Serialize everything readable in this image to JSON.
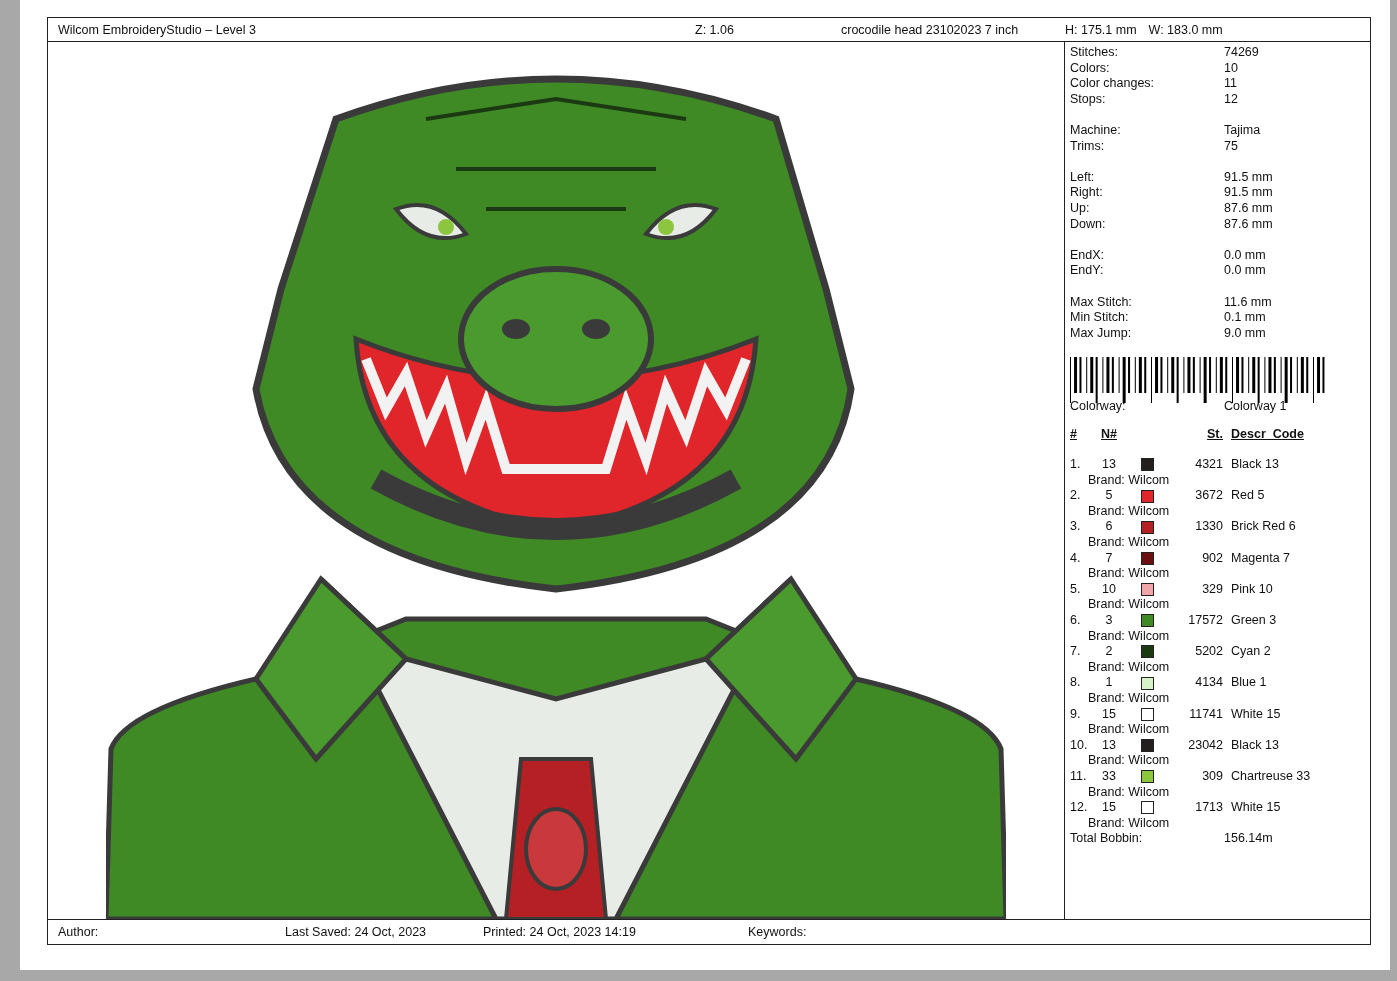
{
  "header": {
    "title": "Wilcom EmbroideryStudio – Level 3",
    "zoom": "Z: 1.06",
    "design_name": "crocodile head 23102023 7 inch",
    "height": "H: 175.1 mm",
    "width": "W: 183.0 mm"
  },
  "stats": [
    [
      {
        "label": "Stitches:",
        "value": "74269"
      },
      {
        "label": "Colors:",
        "value": "10"
      },
      {
        "label": "Color changes:",
        "value": "11"
      },
      {
        "label": "Stops:",
        "value": "12"
      }
    ],
    [
      {
        "label": "Machine:",
        "value": "Tajima"
      },
      {
        "label": "Trims:",
        "value": "75"
      }
    ],
    [
      {
        "label": "Left:",
        "value": "91.5 mm"
      },
      {
        "label": "Right:",
        "value": "91.5 mm"
      },
      {
        "label": "Up:",
        "value": "87.6 mm"
      },
      {
        "label": "Down:",
        "value": "87.6 mm"
      }
    ],
    [
      {
        "label": "EndX:",
        "value": "0.0 mm"
      },
      {
        "label": "EndY:",
        "value": "0.0 mm"
      }
    ],
    [
      {
        "label": "Max Stitch:",
        "value": "11.6 mm"
      },
      {
        "label": "Min Stitch:",
        "value": "0.1 mm"
      },
      {
        "label": "Max Jump:",
        "value": "9.0 mm"
      }
    ]
  ],
  "colorway": {
    "label": "Colorway:",
    "value": "Colorway 1"
  },
  "color_table": {
    "columns": [
      "#",
      "N#",
      "St.",
      "Descr_Code"
    ],
    "rows": [
      {
        "index": "1.",
        "number": "13",
        "color": "#231f1e",
        "stitches": "4321",
        "description": "Black 13",
        "brand": "Brand: Wilcom"
      },
      {
        "index": "2.",
        "number": "5",
        "color": "#e0262a",
        "stitches": "3672",
        "description": "Red 5",
        "brand": "Brand: Wilcom"
      },
      {
        "index": "3.",
        "number": "6",
        "color": "#b52025",
        "stitches": "1330",
        "description": "Brick Red 6",
        "brand": "Brand: Wilcom"
      },
      {
        "index": "4.",
        "number": "7",
        "color": "#6b0f12",
        "stitches": "902",
        "description": "Magenta 7",
        "brand": "Brand: Wilcom"
      },
      {
        "index": "5.",
        "number": "10",
        "color": "#f0a5a8",
        "stitches": "329",
        "description": "Pink 10",
        "brand": "Brand: Wilcom"
      },
      {
        "index": "6.",
        "number": "3",
        "color": "#3f8a25",
        "stitches": "17572",
        "description": "Green 3",
        "brand": "Brand: Wilcom"
      },
      {
        "index": "7.",
        "number": "2",
        "color": "#1c3a12",
        "stitches": "5202",
        "description": "Cyan 2",
        "brand": "Brand: Wilcom"
      },
      {
        "index": "8.",
        "number": "1",
        "color": "#d5f2c8",
        "stitches": "4134",
        "description": "Blue 1",
        "brand": "Brand: Wilcom"
      },
      {
        "index": "9.",
        "number": "15",
        "color": "#ffffff",
        "stitches": "11741",
        "description": "White 15",
        "brand": "Brand: Wilcom"
      },
      {
        "index": "10.",
        "number": "13",
        "color": "#231f1e",
        "stitches": "23042",
        "description": "Black 13",
        "brand": "Brand: Wilcom"
      },
      {
        "index": "11.",
        "number": "33",
        "color": "#8cc63f",
        "stitches": "309",
        "description": "Chartreuse 33",
        "brand": "Brand: Wilcom"
      },
      {
        "index": "12.",
        "number": "15",
        "color": "#ffffff",
        "stitches": "1713",
        "description": "White 15",
        "brand": "Brand: Wilcom"
      }
    ]
  },
  "total_bobbin": {
    "label": "Total Bobbin:",
    "value": "156.14m"
  },
  "footer": {
    "author": "Author:",
    "last_saved": "Last Saved: 24 Oct, 2023",
    "printed": "Printed: 24 Oct, 2023 14:19",
    "keywords": "Keywords:"
  }
}
